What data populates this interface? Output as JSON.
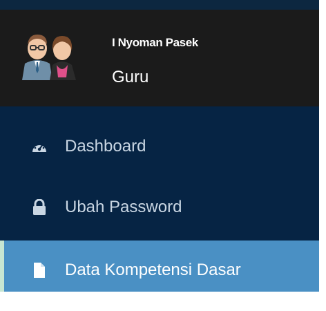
{
  "user": {
    "name": "I Nyoman Pasek",
    "role": "Guru"
  },
  "menu": {
    "items": [
      {
        "label": "Dashboard",
        "icon": "dashboard-gauge-icon",
        "active": false
      },
      {
        "label": "Ubah Password",
        "icon": "lock-icon",
        "active": false
      },
      {
        "label": "Data Kompetensi Dasar",
        "icon": "file-icon",
        "active": true
      }
    ]
  },
  "colors": {
    "header_bg": "#1b1b1b",
    "menu_bg": "#062444",
    "active_bg": "#4a90c4",
    "active_indicator": "#c7e6d2"
  }
}
